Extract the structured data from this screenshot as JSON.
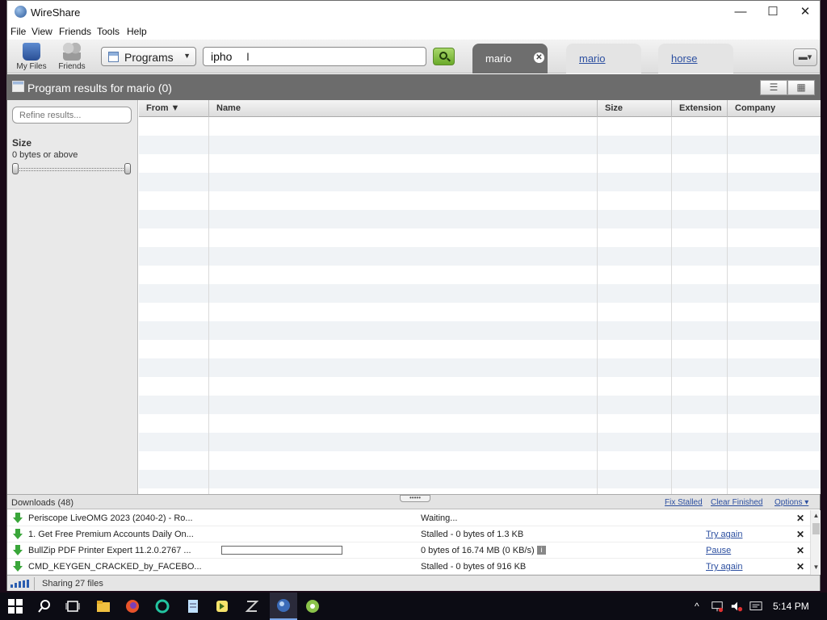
{
  "window": {
    "title": "WireShare",
    "min": "—",
    "max": "☐",
    "close": "✕"
  },
  "menu": [
    "File",
    "View",
    "Friends",
    "Tools",
    "Help"
  ],
  "toolbar": {
    "my_files": "My Files",
    "friends": "Friends",
    "category": "Programs",
    "search_value": "ipho"
  },
  "tabs": [
    {
      "label": "mario",
      "active": true,
      "close": "✕"
    },
    {
      "label": "mario",
      "active": false
    },
    {
      "label": "horse",
      "active": false
    }
  ],
  "results": {
    "title": "Program results for mario (0)",
    "list_view": "☰",
    "grid_view": "▦"
  },
  "sidebar": {
    "refine_placeholder": "Refine results...",
    "size_heading": "Size",
    "size_sub": "0 bytes or above"
  },
  "columns": [
    "From ▼",
    "Name",
    "Size",
    "Extension",
    "Company"
  ],
  "downloads": {
    "title": "Downloads (48)",
    "fix_stalled": "Fix Stalled",
    "clear_finished": "Clear Finished",
    "options": "Options ▾",
    "grip": "•••••",
    "items": [
      {
        "name": "Periscope LiveOMG 2023 (2040-2) - Ro...",
        "status": "Waiting...",
        "action": "",
        "progress": null
      },
      {
        "name": "1. Get Free Premium Accounts Daily On...",
        "status": "Stalled - 0 bytes of 1.3 KB",
        "action": "Try again",
        "progress": null
      },
      {
        "name": "BullZip PDF Printer Expert 11.2.0.2767 ...",
        "status": "0 bytes of 16.74 MB (0 KB/s)",
        "action": "Pause",
        "progress": 0
      },
      {
        "name": "CMD_KEYGEN_CRACKED_by_FACEBO...",
        "status": "Stalled - 0 bytes of 916 KB",
        "action": "Try again",
        "progress": null
      }
    ],
    "close_glyph": "✕",
    "info_glyph": "i"
  },
  "status": {
    "sharing": "Sharing 27 files"
  },
  "taskbar": {
    "time": "5:14 PM"
  }
}
